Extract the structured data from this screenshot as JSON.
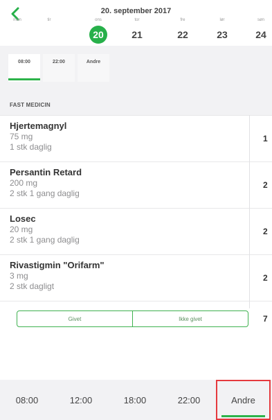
{
  "header": {
    "back_icon": "chevron-left-icon",
    "accent": "#27b04a",
    "date_title": "20. september 2017"
  },
  "days": [
    {
      "name": "man",
      "num": ""
    },
    {
      "name": "tir",
      "num": ""
    },
    {
      "name": "ons",
      "num": "20"
    },
    {
      "name": "tor",
      "num": "21"
    },
    {
      "name": "fre",
      "num": "22"
    },
    {
      "name": "lør",
      "num": "23"
    },
    {
      "name": "søn",
      "num": "24"
    }
  ],
  "top_tabs": [
    "08:00",
    "22:00",
    "Andre"
  ],
  "section": {
    "title": "FAST MEDICIN"
  },
  "meds": [
    {
      "name": "Hjertemagnyl",
      "dose": "75 mg",
      "freq": "1 stk daglig",
      "qty": "1"
    },
    {
      "name": "Persantin Retard",
      "dose": "200 mg",
      "freq": "2 stk 1 gang daglig",
      "qty": "2"
    },
    {
      "name": "Losec",
      "dose": "20 mg",
      "freq": "2 stk 1 gang daglig",
      "qty": "2"
    },
    {
      "name": "Rivastigmin \"Orifarm\"",
      "dose": "3 mg",
      "freq": "2 stk dagligt",
      "qty": "2"
    }
  ],
  "given": {
    "given_label": "Givet",
    "not_given_label": "Ikke givet",
    "qty": "7"
  },
  "bottom_tabs": [
    "08:00",
    "12:00",
    "18:00",
    "22:00",
    "Andre"
  ],
  "colors": {
    "green": "#2db34a",
    "selected_border": "#e5393e",
    "band": "#f2f2f4"
  }
}
